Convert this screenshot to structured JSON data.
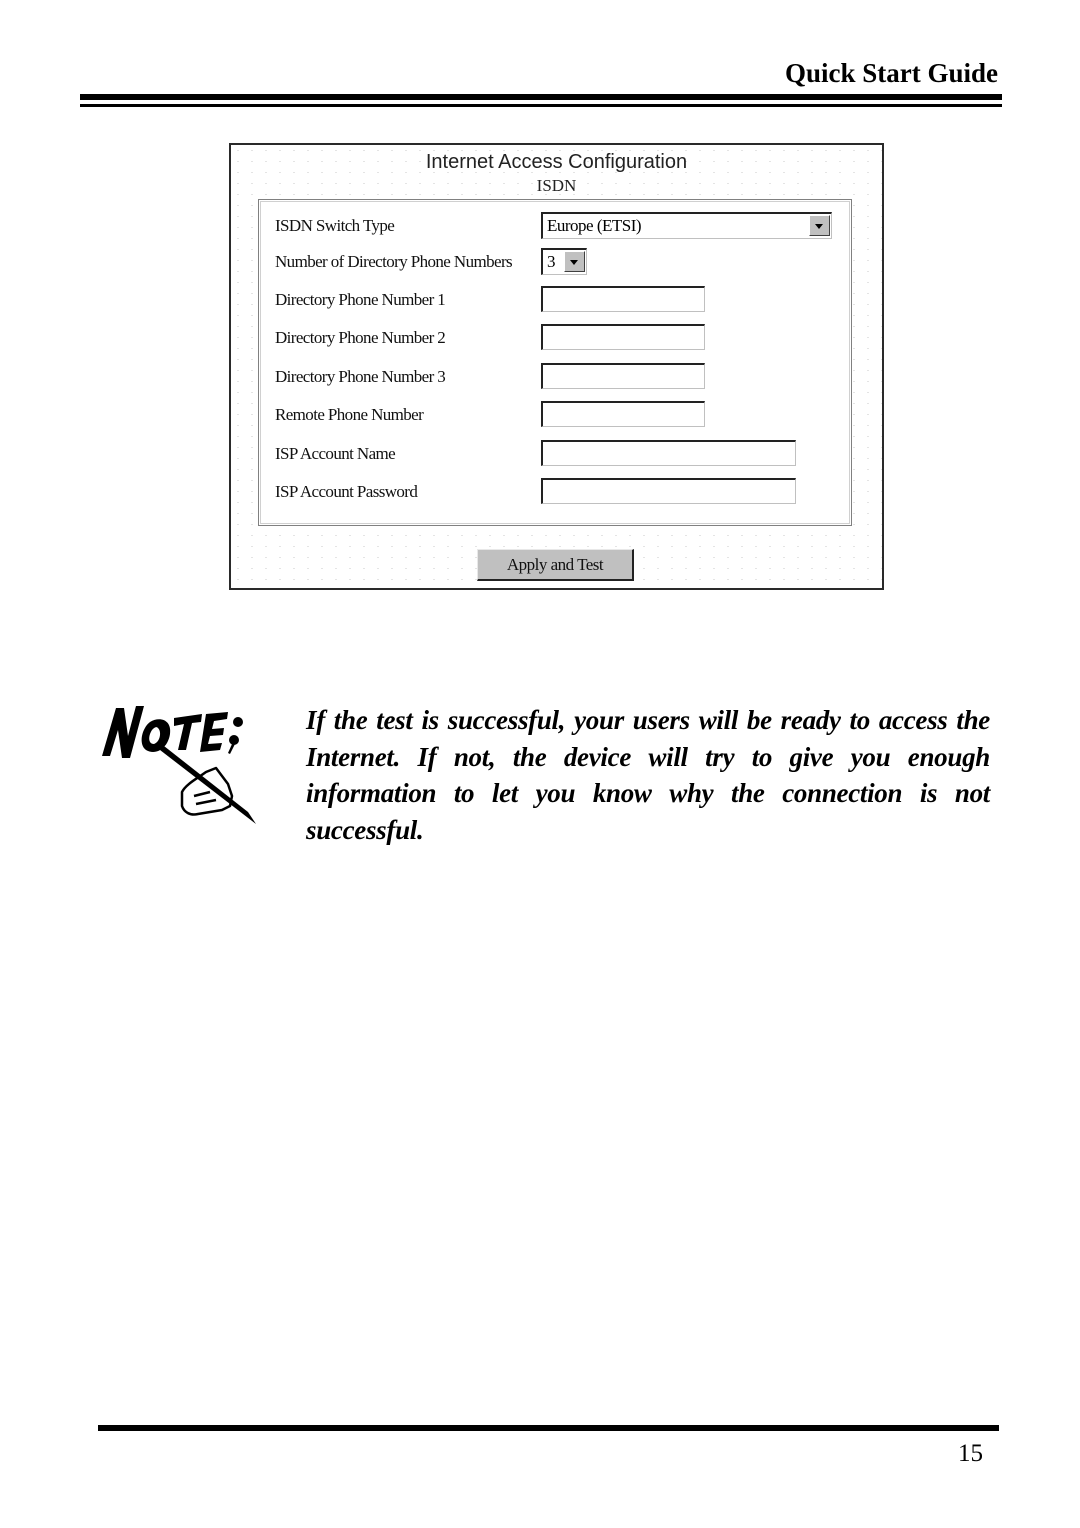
{
  "running_head": "Quick Start Guide",
  "screenshot": {
    "title": "Internet Access Configuration",
    "subtitle": "ISDN",
    "fields": [
      {
        "label": "ISDN Switch Type",
        "type": "select",
        "value": "Europe (ETSI)"
      },
      {
        "label": "Number of Directory Phone Numbers",
        "type": "select",
        "value": "3"
      },
      {
        "label": "Directory Phone Number 1",
        "type": "text",
        "value": ""
      },
      {
        "label": "Directory Phone Number 2",
        "type": "text",
        "value": ""
      },
      {
        "label": "Directory Phone Number 3",
        "type": "text",
        "value": ""
      },
      {
        "label": "Remote Phone Number",
        "type": "text",
        "value": ""
      },
      {
        "label": "ISP Account Name",
        "type": "text",
        "value": ""
      },
      {
        "label": "ISP Account Password",
        "type": "password",
        "value": ""
      }
    ],
    "apply_button": "Apply and Test"
  },
  "note": {
    "icon": "note-pen-hand-icon",
    "logo_text": "NOTE:",
    "text": "If the test is successful, your users will be ready to access the Internet. If not, the device will try to give you enough information to let you know why the connection is not successful."
  },
  "page_number": "15"
}
